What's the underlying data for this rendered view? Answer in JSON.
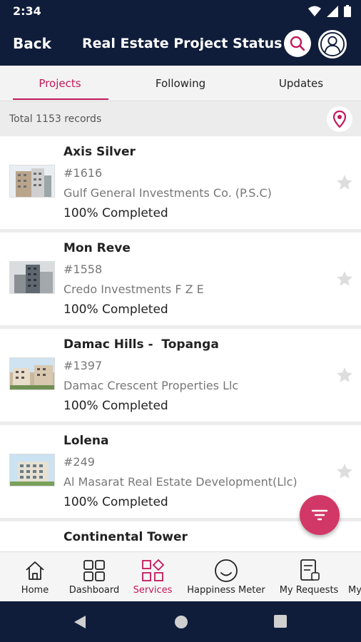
{
  "status_bar": {
    "time": "2:34",
    "icons": [
      "wifi-icon",
      "signal-icon",
      "battery-icon"
    ]
  },
  "header": {
    "back_label": "Back",
    "title": "Real Estate Project Status",
    "icons": [
      "search-icon",
      "profile-icon"
    ]
  },
  "tabs": [
    {
      "label": "Projects",
      "active": true
    },
    {
      "label": "Following",
      "active": false
    },
    {
      "label": "Updates",
      "active": false
    }
  ],
  "records": {
    "total_text": "Total 1153 records",
    "icon": "location-pin-icon"
  },
  "projects": [
    {
      "name": "Axis Silver",
      "id": "#1616",
      "developer": "Gulf General Investments Co. (P.S.C)",
      "status": "100% Completed"
    },
    {
      "name": "Mon Reve",
      "id": "#1558",
      "developer": "Credo Investments F Z E",
      "status": "100% Completed"
    },
    {
      "name": "Damac Hills -  Topanga",
      "id": "#1397",
      "developer": "Damac Crescent Properties Llc",
      "status": "100% Completed"
    },
    {
      "name": "Lolena",
      "id": "#249",
      "developer": "Al Masarat Real Estate Development(Llc)",
      "status": "100% Completed"
    },
    {
      "name": "Continental Tower",
      "id": "",
      "developer": "",
      "status": ""
    }
  ],
  "fab": {
    "icon": "filter-icon"
  },
  "bottom_nav": [
    {
      "label": "Home",
      "icon": "home-icon",
      "active": false
    },
    {
      "label": "Dashboard",
      "icon": "dashboard-icon",
      "active": false
    },
    {
      "label": "Services",
      "icon": "services-icon",
      "active": true
    },
    {
      "label": "Happiness Meter",
      "icon": "smiley-icon",
      "active": false
    },
    {
      "label": "My Requests",
      "icon": "requests-icon",
      "active": false
    },
    {
      "label": "My",
      "icon": "",
      "active": false
    }
  ],
  "colors": {
    "primary_dark": "#0f1d3a",
    "accent": "#c2185b",
    "fab": "#d23867",
    "star": "#dddddd"
  }
}
